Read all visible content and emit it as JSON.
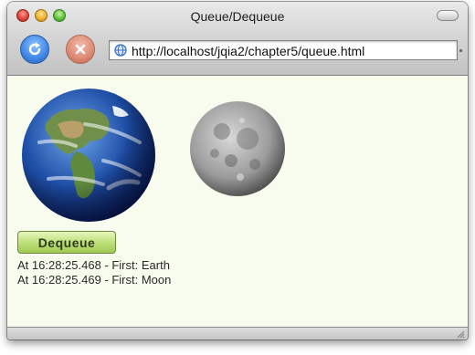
{
  "window": {
    "title": "Queue/Dequeue"
  },
  "toolbar": {
    "url": "http://localhost/jqia2/chapter5/queue.html"
  },
  "content": {
    "images": [
      {
        "name": "earth-image"
      },
      {
        "name": "moon-image"
      }
    ],
    "button_label": "Dequeue",
    "log": [
      "At 16:28:25.468 - First: Earth",
      "At 16:28:25.469 - First: Moon"
    ]
  },
  "colors": {
    "page_background": "#f8fcee",
    "button_green": "#bfe07a",
    "reload_blue": "#3f86e6",
    "stop_red": "#e0836a"
  },
  "icons": [
    "close-icon",
    "minimize-icon",
    "zoom-icon",
    "toolbar-toggle-icon",
    "reload-icon",
    "stop-icon",
    "globe-icon",
    "resize-grip-icon"
  ]
}
